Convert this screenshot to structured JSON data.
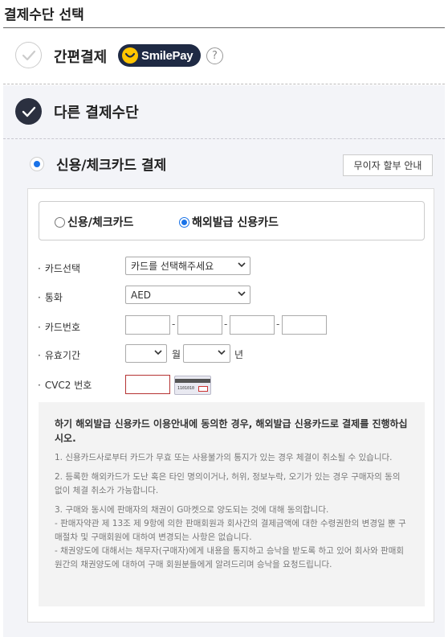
{
  "page": {
    "title": "결제수단 선택"
  },
  "quick_pay": {
    "label": "간편결제",
    "brand": "SmilePay",
    "help": "?"
  },
  "other_pay": {
    "label": "다른 결제수단",
    "method_title": "신용/체크카드 결제",
    "installment_button": "무이자 할부 안내",
    "card_types": [
      {
        "label": "신용/체크카드",
        "selected": false
      },
      {
        "label": "해외발급 신용카드",
        "selected": true
      }
    ],
    "form": {
      "card_select": {
        "label": "카드선택",
        "value": "카드를 선택해주세요"
      },
      "currency": {
        "label": "통화",
        "value": "AED"
      },
      "card_number": {
        "label": "카드번호",
        "separator": "-"
      },
      "expiry": {
        "label": "유효기간",
        "month_unit": "월",
        "year_unit": "년"
      },
      "cvc": {
        "label": "CVC2 번호",
        "card_image_number": "1101010"
      }
    },
    "notice": {
      "heading": "하기 해외발급 신용카드 이용안내에 동의한 경우, 해외발급 신용카드로 결제를 진행하십시오.",
      "items": [
        "1. 신용카드사로부터 카드가 무효 또는 사용불가의 통지가 있는 경우 체결이 취소될 수 있습니다.",
        "2. 등록한 해외카드가 도난 혹은 타인 명의이거나, 허위, 정보누락, 오기가 있는 경우 구매자의 동의 없이 체결 취소가 가능합니다.",
        "3. 구매와 동시에 판매자의 채권이 G마켓으로 양도되는 것에 대해 동의합니다.\n- 판매자약관 제 13조 제 9항에 의한 판매회원과 회사간의 결제금액에 대한 수령권한의 변경일 뿐 구매절차 및 구매회원에 대하여 변경되는 사항은 없습니다.\n- 채권양도에 대해서는 채무자(구매자)에게 내용을 통지하고 승낙을 받도록 하고 있어 회사와 판매회원간의 채권양도에 대하여 구매 회원분들에게 알려드리며 승낙을 요청드립니다."
      ]
    }
  },
  "colors": {
    "accent": "#1a73e8",
    "dark_check": "#2b3040",
    "brand_bg": "#1f2a44",
    "brand_yellow": "#ffc400",
    "error_border": "#b53333"
  }
}
